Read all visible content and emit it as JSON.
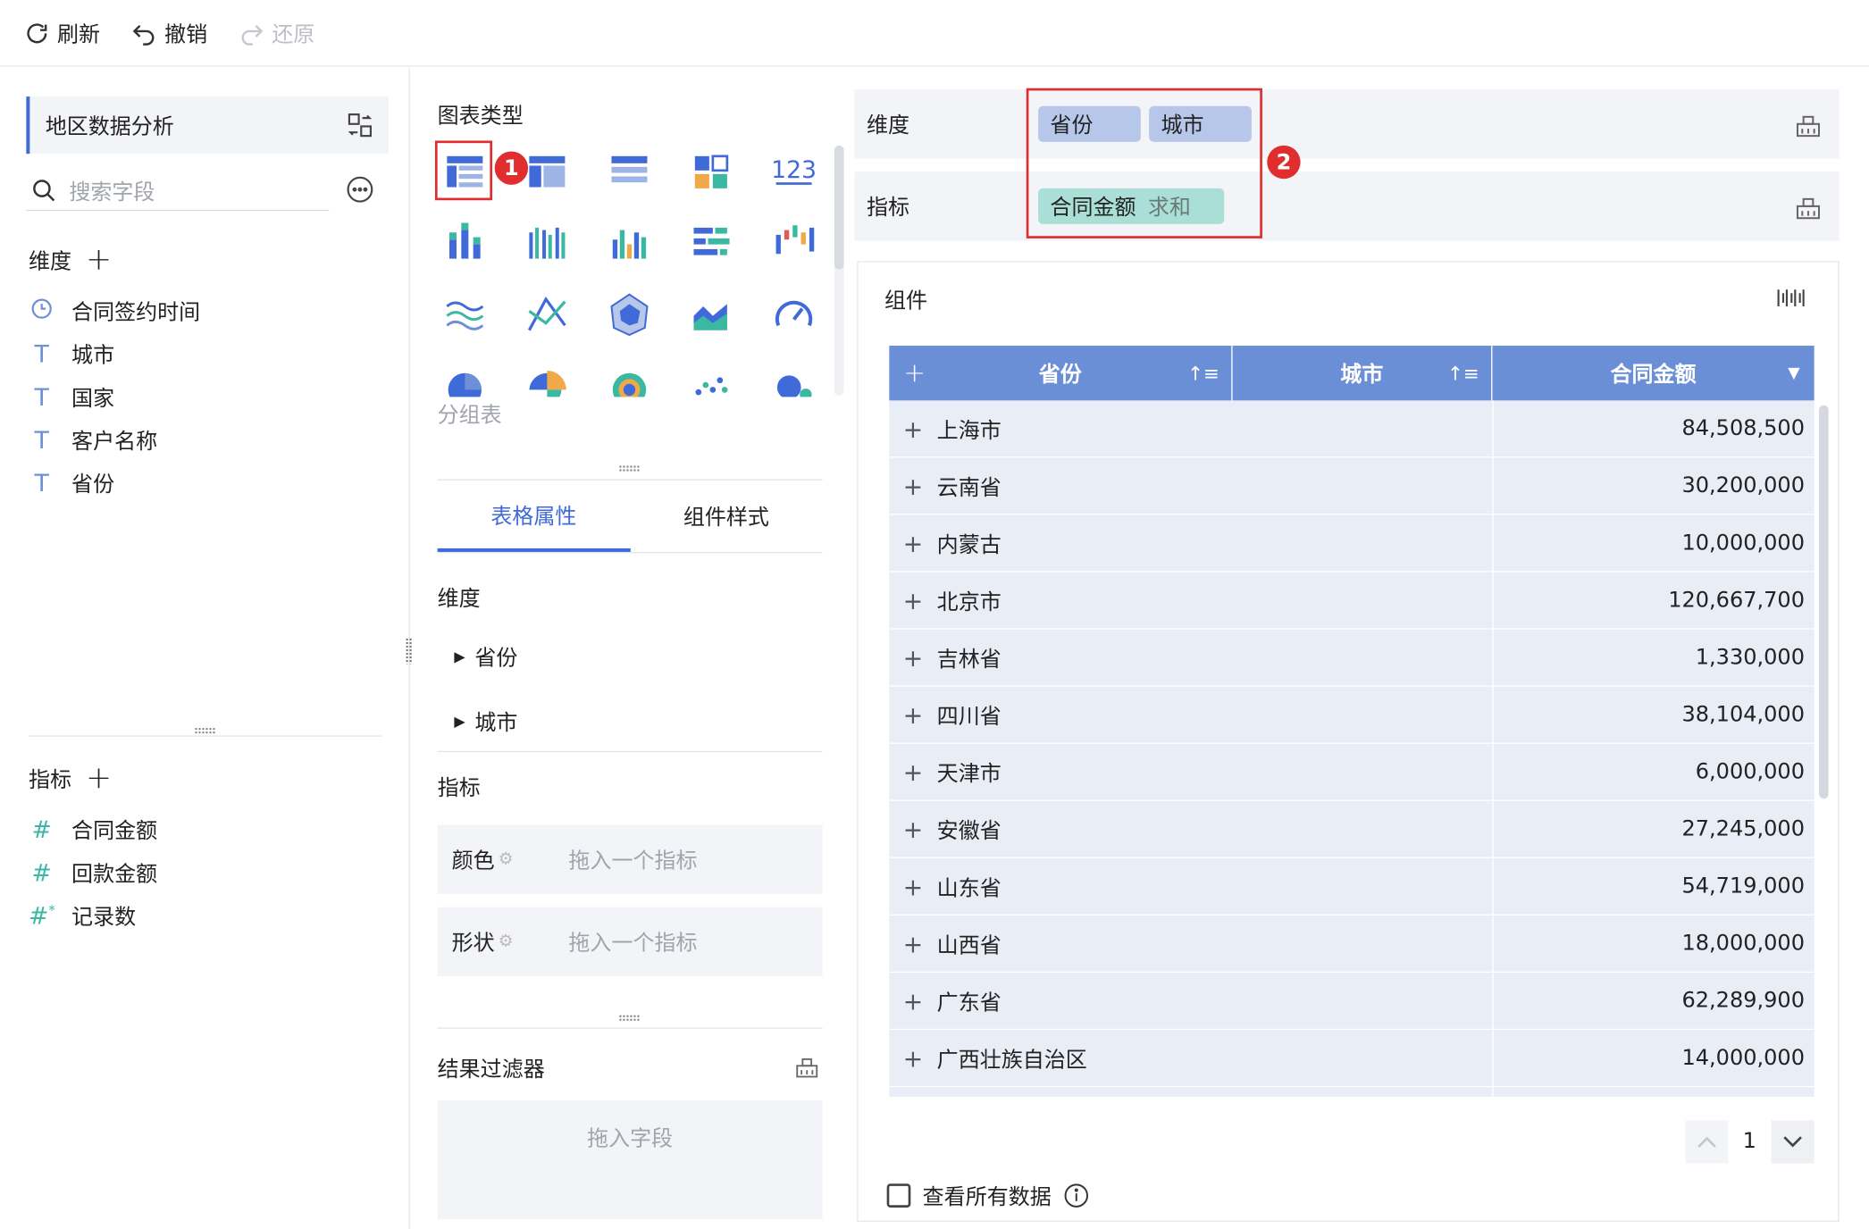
{
  "toolbar": {
    "refresh": "刷新",
    "undo": "撤销",
    "redo": "还原"
  },
  "left": {
    "dataset": "地区数据分析",
    "search_placeholder": "搜索字段",
    "dimension_title": "维度",
    "dimensions": [
      {
        "icon": "clock-icon",
        "label": "合同签约时间"
      },
      {
        "icon": "text-type-icon",
        "label": "城市"
      },
      {
        "icon": "text-type-icon",
        "label": "国家"
      },
      {
        "icon": "text-type-icon",
        "label": "客户名称"
      },
      {
        "icon": "text-type-icon",
        "label": "省份"
      }
    ],
    "metric_title": "指标",
    "metrics": [
      {
        "icon": "number-icon",
        "label": "合同金额"
      },
      {
        "icon": "number-icon",
        "label": "回款金额"
      },
      {
        "icon": "number-star-icon",
        "label": "记录数"
      }
    ]
  },
  "middle": {
    "chart_type_title": "图表类型",
    "chart_caption": "分组表",
    "tabs": [
      "表格属性",
      "组件样式"
    ],
    "dimension_title": "维度",
    "dimension_items": [
      "省份",
      "城市"
    ],
    "metric_title": "指标",
    "color_label": "颜色",
    "shape_label": "形状",
    "drop_placeholder": "拖入一个指标",
    "filter_title": "结果过滤器",
    "filter_placeholder": "拖入字段"
  },
  "right": {
    "dimension_label": "维度",
    "dimension_pills": [
      "省份",
      "城市"
    ],
    "metric_label": "指标",
    "metric_pill": "合同金额",
    "metric_agg": "求和",
    "badges": [
      "1",
      "2"
    ],
    "component_title": "组件",
    "table": {
      "headers": [
        "省份",
        "城市",
        "合同金额"
      ],
      "rows": [
        {
          "province": "上海市",
          "amount": "84,508,500"
        },
        {
          "province": "云南省",
          "amount": "30,200,000"
        },
        {
          "province": "内蒙古",
          "amount": "10,000,000"
        },
        {
          "province": "北京市",
          "amount": "120,667,700"
        },
        {
          "province": "吉林省",
          "amount": "1,330,000"
        },
        {
          "province": "四川省",
          "amount": "38,104,000"
        },
        {
          "province": "天津市",
          "amount": "6,000,000"
        },
        {
          "province": "安徽省",
          "amount": "27,245,000"
        },
        {
          "province": "山东省",
          "amount": "54,719,000"
        },
        {
          "province": "山西省",
          "amount": "18,000,000"
        },
        {
          "province": "广东省",
          "amount": "62,289,900"
        },
        {
          "province": "广西壮族自治区",
          "amount": "14,000,000"
        }
      ]
    },
    "page": "1",
    "view_all": "查看所有数据"
  },
  "colors": {
    "accent": "#3f6ad8",
    "header": "#6b8fd6",
    "dim_pill": "#b6c7ea",
    "metric_pill": "#a9dfd6",
    "highlight": "#e02d2d"
  }
}
